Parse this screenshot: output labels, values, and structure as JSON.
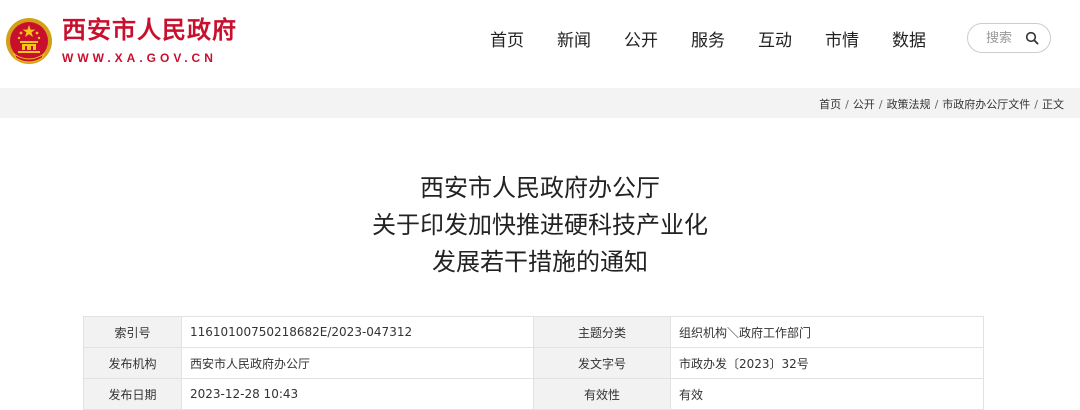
{
  "header": {
    "site_title": "西安市人民政府",
    "site_url": "WWW.XA.GOV.CN",
    "emblem_icon": "national-emblem-icon",
    "brand_color": "#c8102e"
  },
  "nav": {
    "items": [
      {
        "label": "首页"
      },
      {
        "label": "新闻"
      },
      {
        "label": "公开"
      },
      {
        "label": "服务"
      },
      {
        "label": "互动"
      },
      {
        "label": "市情"
      },
      {
        "label": "数据"
      }
    ]
  },
  "search": {
    "placeholder": "搜索",
    "icon": "search-icon"
  },
  "breadcrumb": {
    "items": [
      "首页",
      "公开",
      "政策法规",
      "市政府办公厅文件",
      "正文"
    ],
    "separator": "/"
  },
  "document": {
    "title_lines": [
      "西安市人民政府办公厅",
      "关于印发加快推进硬科技产业化",
      "发展若干措施的通知"
    ]
  },
  "info_table": {
    "rows": [
      {
        "label1": "索引号",
        "value1": "11610100750218682E/2023-047312",
        "label2": "主题分类",
        "value2": "组织机构＼政府工作部门"
      },
      {
        "label1": "发布机构",
        "value1": "西安市人民政府办公厅",
        "label2": "发文字号",
        "value2": "市政办发〔2023〕32号"
      },
      {
        "label1": "发布日期",
        "value1": "2023-12-28 10:43",
        "label2": "有效性",
        "value2": "有效"
      }
    ]
  }
}
